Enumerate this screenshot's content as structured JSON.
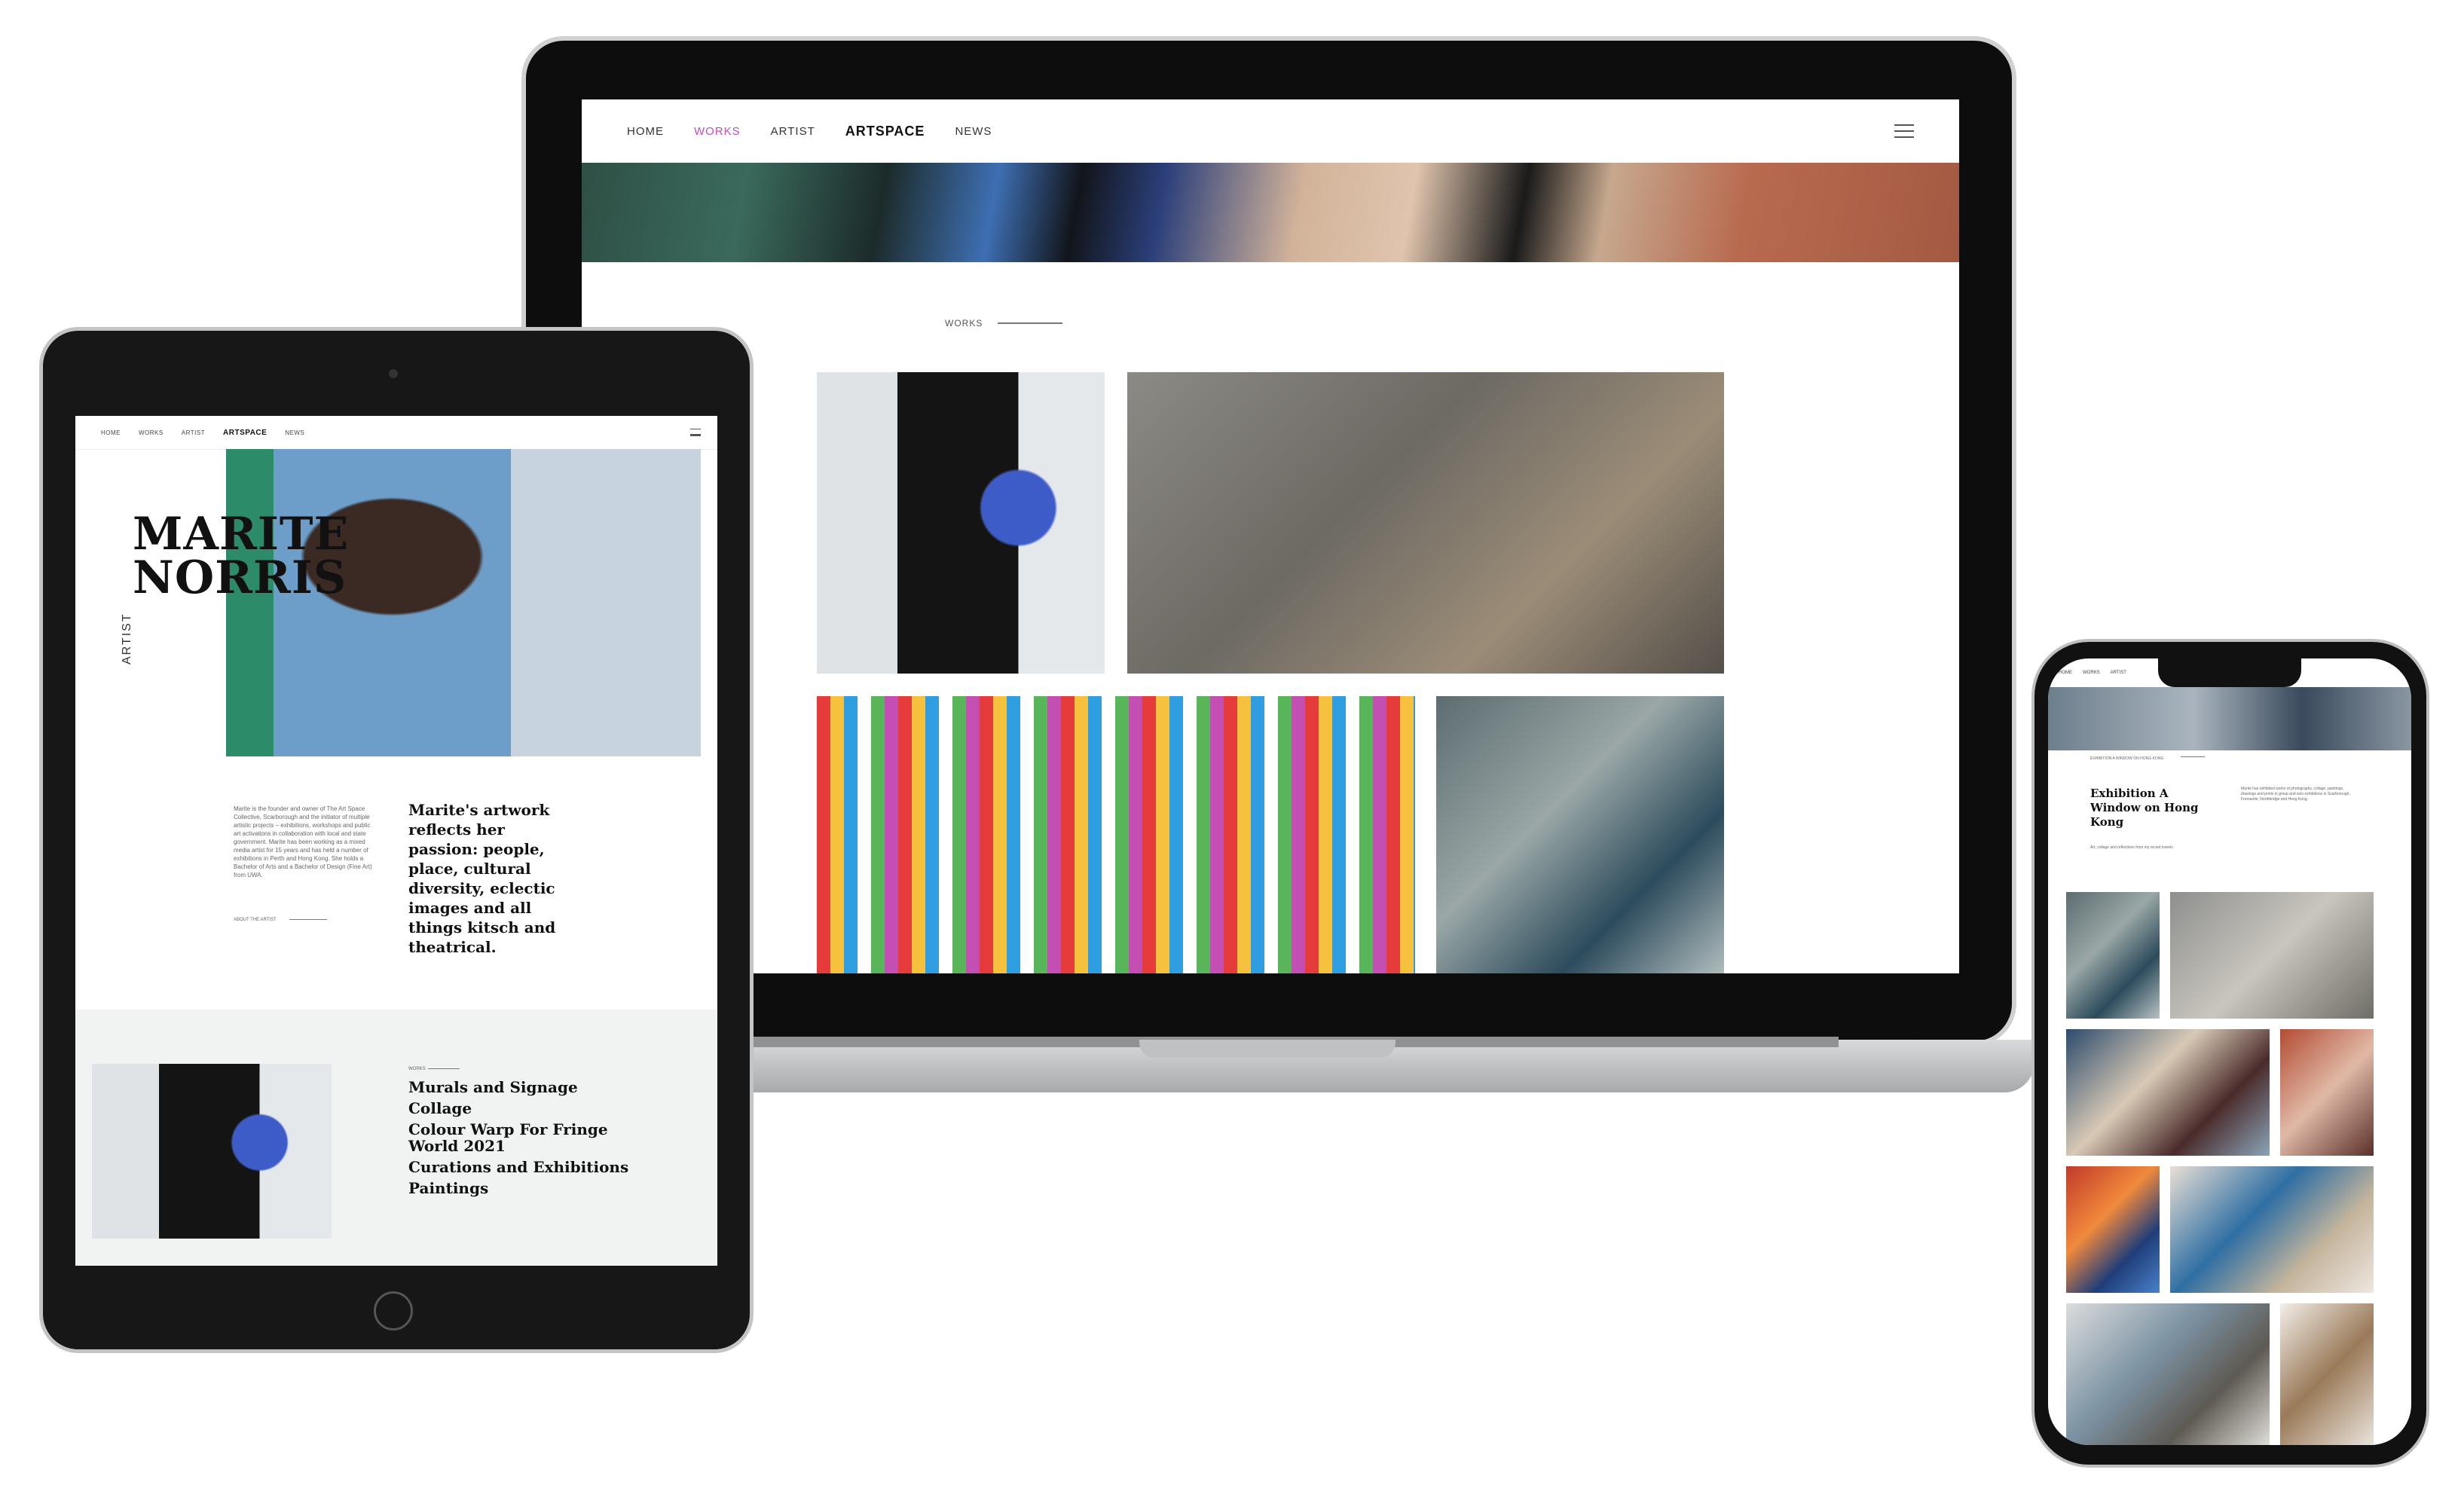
{
  "laptop": {
    "nav": [
      "HOME",
      "WORKS",
      "ARTIST",
      "NEWS"
    ],
    "logo": "ARTSPACE",
    "active_color": "#c04ec1",
    "section_label": "WORKS"
  },
  "tablet": {
    "nav": [
      "HOME",
      "WORKS",
      "ARTIST",
      "NEWS"
    ],
    "logo": "ARTSPACE",
    "name_line1": "MARITE",
    "name_line2": "NORRIS",
    "role": "ARTIST",
    "tagline": "Marite's artwork reflects her passion: people, place, cultural diversity, eclectic images and all things kitsch and theatrical.",
    "about_link": "ABOUT THE ARTIST",
    "bio": "Marite is the founder and owner of The Art Space Collective, Scarborough and the initiator of multiple artistic projects – exhibitions, workshops and public art activations in collaboration with local and state government. Marite has been working as a mixed media artist for 15 years and has held a number of exhibitions in Perth and Hong Kong. She holds a Bachelor of Arts and a Bachelor of Design (Fine Art) from UWA.",
    "works_label": "WORKS",
    "works": [
      "Murals and Signage",
      "Collage",
      "Colour Warp For Fringe World 2021",
      "Curations and Exhibitions",
      "Paintings"
    ]
  },
  "phone": {
    "nav": [
      "HOME",
      "WORKS",
      "ARTIST"
    ],
    "exhibition_label": "EXHIBITION A WINDOW ON HONG KONG",
    "exhibition_title": "Exhibition A Window on Hong Kong",
    "exhibition_sub": "Art, collage and reflections from my recent travels",
    "exhibition_desc": "Marite has exhibited works of photography, collage, paintings, drawings and prints in group and solo exhibitions in Scarborough, Fremantle, Northbridge and Hong Kong."
  }
}
